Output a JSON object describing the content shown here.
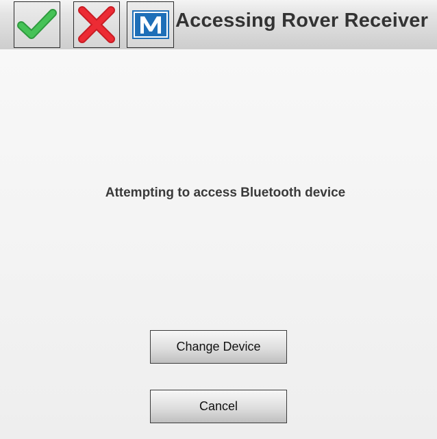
{
  "titlebar": {
    "title": "Accessing Rover Receiver",
    "buttons": [
      {
        "icon": "checkmark-icon",
        "color": "#3cb54a"
      },
      {
        "icon": "x-icon",
        "color": "#e8262f"
      },
      {
        "icon": "m-logo-icon",
        "color": "#1e6fb8",
        "text": "M"
      }
    ]
  },
  "main": {
    "message": "Attempting to access Bluetooth device"
  },
  "actions": {
    "change_device_label": "Change Device",
    "cancel_label": "Cancel"
  }
}
